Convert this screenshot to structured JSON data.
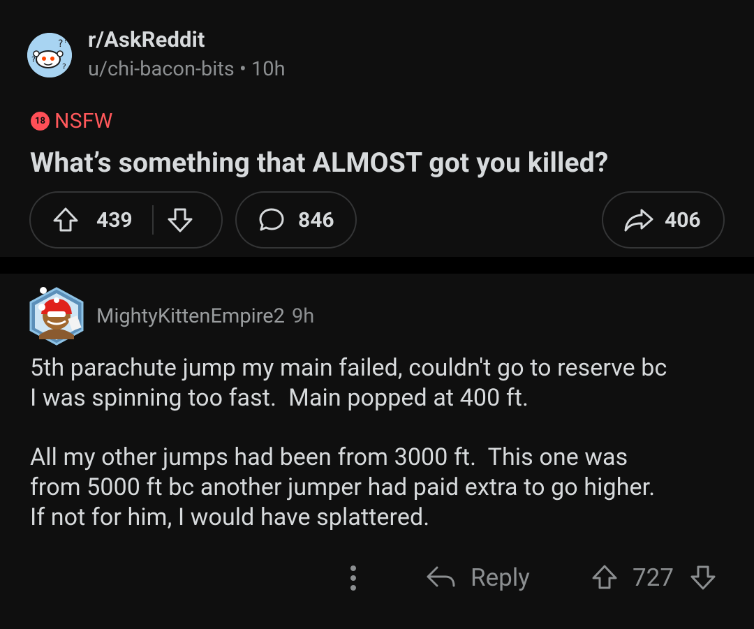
{
  "post": {
    "subreddit": "r/AskReddit",
    "author": "u/chi-bacon-bits",
    "separator": "•",
    "age": "10h",
    "nsfw_badge": "18",
    "nsfw_label": "NSFW",
    "title": "What’s something that ALMOST got you killed?",
    "upvotes": "439",
    "comments": "846",
    "shares": "406"
  },
  "comment": {
    "username": "MightyKittenEmpire2",
    "age": "9h",
    "paragraphs": [
      "5th parachute jump my main failed, couldn't go to reserve bc\nI was spinning too fast.  Main popped at 400 ft.",
      "All my other jumps had been from 3000 ft.  This one was\nfrom 5000 ft bc another jumper had paid extra to go higher.\nIf not for him, I would have splattered."
    ],
    "reply_label": "Reply",
    "score": "727"
  },
  "icons": {
    "upvote": "upvote-arrow-icon",
    "downvote": "downvote-arrow-icon",
    "comment": "speech-bubble-icon",
    "share": "share-arrow-icon",
    "reply": "reply-arrow-icon",
    "more": "vertical-dots-icon"
  },
  "colors": {
    "background": "#0f0f0f",
    "nsfw": "#ff585b",
    "text": "#d7dadc",
    "muted": "#8c8f91",
    "border": "#343536"
  }
}
